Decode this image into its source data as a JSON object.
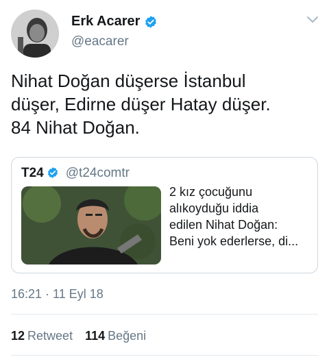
{
  "author": {
    "display_name": "Erk Acarer",
    "handle": "@eacarer",
    "verified_color": "#1da1f2"
  },
  "tweet": {
    "text": "Nihat Doğan düşerse İstanbul\ndüşer, Edirne düşer Hatay düşer.\n84 Nihat Doğan."
  },
  "quoted": {
    "name": "T24",
    "handle": "@t24comtr",
    "text": "2 kız çocuğunu\nalıkoyduğu iddia\nedilen Nihat Doğan:\nBeni yok ederlerse, di..."
  },
  "meta": {
    "timestamp": "16:21 · 11 Eyl 18"
  },
  "stats": {
    "retweet_count": "12",
    "retweet_label": "Retweet",
    "like_count": "114",
    "like_label": "Beğeni"
  },
  "icons": {
    "verified": "verified-badge-icon",
    "menu": "chevron-down-icon"
  }
}
